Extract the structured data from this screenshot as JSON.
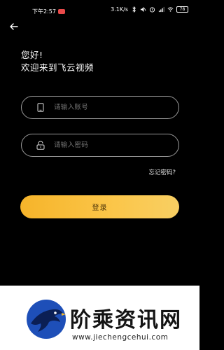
{
  "status_bar": {
    "time": "下午2:57",
    "network_speed": "3.1K/s",
    "battery": "78"
  },
  "header": {
    "back_icon": "back-arrow-icon"
  },
  "greeting": {
    "line1": "您好!",
    "line2": "欢迎来到飞云视频"
  },
  "form": {
    "account_placeholder": "请输入账号",
    "account_icon": "phone-icon",
    "password_placeholder": "请输入密码",
    "password_icon": "lock-icon",
    "forgot_password": "忘记密码?",
    "login_button": "登录"
  },
  "colors": {
    "background": "#000000",
    "accent": "#fbc64a",
    "field_border": "#9a9a9a"
  },
  "watermark": {
    "title": "阶乘资讯网",
    "url": "www.jiechengcehui.com"
  }
}
